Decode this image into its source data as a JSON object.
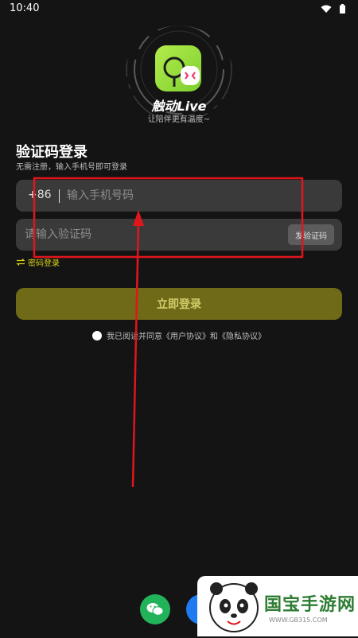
{
  "status_bar": {
    "time": "10:40"
  },
  "branding": {
    "app_name": "触动Live",
    "slogan": "让陪伴更有温度~"
  },
  "login": {
    "title": "验证码登录",
    "subtitle": "无需注册，输入手机号即可登录",
    "country_code": "+86",
    "phone_placeholder": "输入手机号码",
    "phone_value": "",
    "code_placeholder": "请输入验证码",
    "code_value": "",
    "send_code_label": "发验证码",
    "switch_label": "密码登录",
    "submit_label": "立即登录",
    "agreement_text": "我已阅读并同意《用户协议》和《隐私协议》"
  },
  "social": {
    "wechat_icon": "wechat-icon",
    "alt_icon": "app-icon"
  },
  "watermark": {
    "text": "国宝手游网",
    "url": "WWW.GB315.COM"
  },
  "colors": {
    "background": "#141414",
    "field": "#3a3a3a",
    "accent_yellow": "#d9d21a",
    "button": "#6f6a17",
    "annotation_red": "#e0161c",
    "wechat_green": "#22b25a"
  }
}
